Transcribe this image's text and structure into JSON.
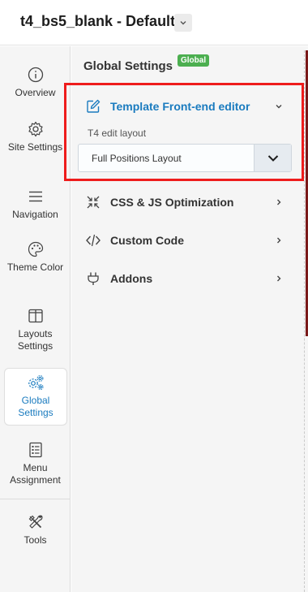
{
  "header": {
    "title": "t4_bs5_blank - Default"
  },
  "sidebar": {
    "items": [
      {
        "label": "Overview",
        "icon": "info-icon"
      },
      {
        "label": "Site Settings",
        "icon": "gear-icon"
      },
      {
        "label": "Navigation",
        "icon": "menu-icon"
      },
      {
        "label": "Theme Color",
        "icon": "palette-icon"
      },
      {
        "label": "Layouts Settings",
        "icon": "layout-icon"
      },
      {
        "label": "Global Settings",
        "icon": "gears-icon",
        "active": true
      },
      {
        "label": "Menu Assignment",
        "icon": "checklist-icon"
      },
      {
        "label": "Tools",
        "icon": "tools-icon"
      }
    ]
  },
  "main": {
    "title": "Global Settings",
    "badge": "Global",
    "sections": [
      {
        "label": "Template Front-end editor",
        "icon": "edit-icon",
        "expanded": true
      },
      {
        "label": "CSS & JS Optimization",
        "icon": "compress-icon",
        "expanded": false
      },
      {
        "label": "Custom Code",
        "icon": "code-icon",
        "expanded": false
      },
      {
        "label": "Addons",
        "icon": "plug-icon",
        "expanded": false
      }
    ],
    "edit_layout": {
      "label": "T4 edit layout",
      "selected": "Full Positions Layout"
    }
  },
  "colors": {
    "accent": "#1a7bbf",
    "badge": "#4caf50",
    "highlight_box": "#ee1c1c"
  }
}
